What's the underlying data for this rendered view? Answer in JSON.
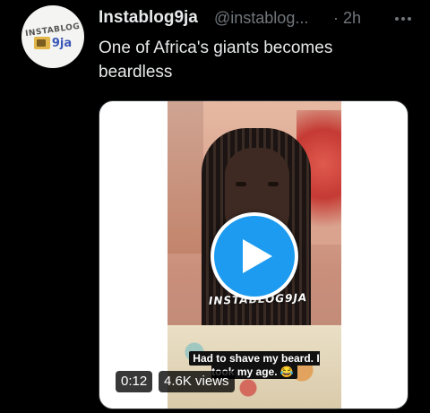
{
  "tweet": {
    "author": {
      "display_name": "Instablog9ja",
      "handle": "@instablog...",
      "avatar_logo_top": "INSTABLOG",
      "avatar_logo_num": "9ja"
    },
    "separator": "·",
    "time": "2h",
    "more_icon": "more-horizontal-icon",
    "text": "One of Africa's giants becomes beardless",
    "media": {
      "type": "video",
      "watermark": "INSTABLOG9JA",
      "caption": "Had to shave my beard. I took my age. 😂",
      "duration": "0:12",
      "views": "4.6K views",
      "play_icon": "play-icon",
      "accent_color": "#1d9bf0"
    }
  }
}
